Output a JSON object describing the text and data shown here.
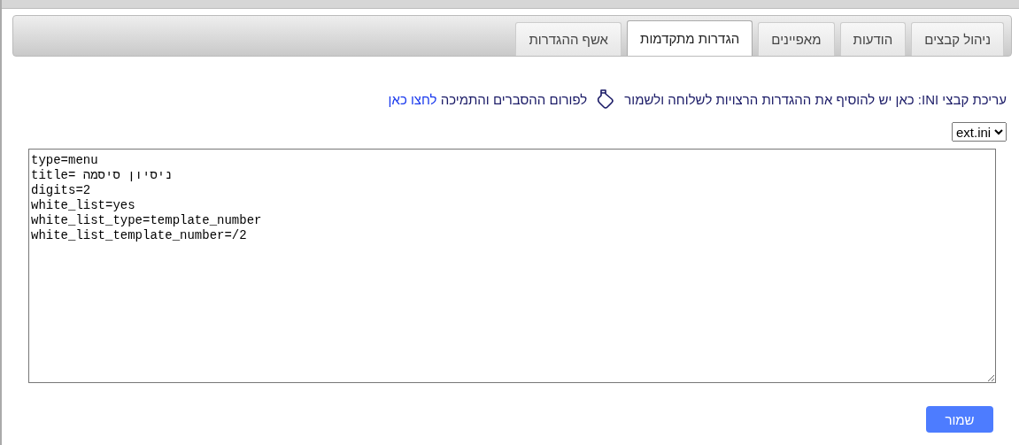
{
  "tabs": [
    {
      "label": "ניהול קבצים",
      "selected": false
    },
    {
      "label": "הודעות",
      "selected": false
    },
    {
      "label": "מאפיינים",
      "selected": false
    },
    {
      "label": "הגדרות מתקדמות",
      "selected": true
    },
    {
      "label": "אשף ההגדרות",
      "selected": false
    }
  ],
  "instruction": {
    "text": "עריכת קבצי INI: כאן יש להוסיף את ההגדרות הרצויות לשלוחה ולשמור",
    "forum_text": "לפורום ההסברים והתמיכה",
    "link": "לחצו כאן"
  },
  "file_select": {
    "value": "ext.ini"
  },
  "editor": {
    "value": "type=menu\ntitle= ניסיון סיסמה\ndigits=2\nwhite_list=yes\nwhite_list_type=template_number\nwhite_list_template_number=/2"
  },
  "save_button": "שמור"
}
